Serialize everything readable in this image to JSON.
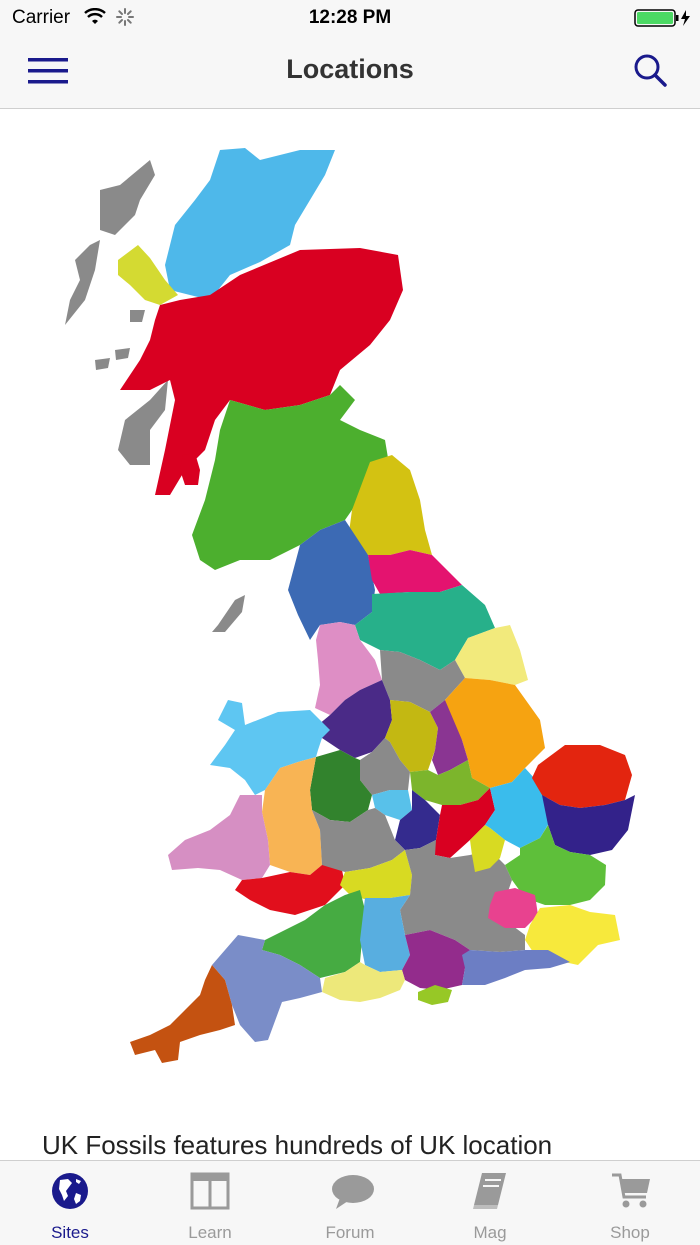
{
  "status_bar": {
    "carrier": "Carrier",
    "time": "12:28 PM"
  },
  "nav": {
    "title": "Locations",
    "menu_icon": "hamburger-menu-icon",
    "search_icon": "search-icon"
  },
  "map": {
    "label": "UK regions map"
  },
  "body": {
    "intro_text": "UK Fossils features hundreds of UK location"
  },
  "tabs": [
    {
      "label": "Sites",
      "icon": "globe-icon",
      "active": true
    },
    {
      "label": "Learn",
      "icon": "book-columns-icon",
      "active": false
    },
    {
      "label": "Forum",
      "icon": "chat-bubble-icon",
      "active": false
    },
    {
      "label": "Mag",
      "icon": "magazine-icon",
      "active": false
    },
    {
      "label": "Shop",
      "icon": "shopping-cart-icon",
      "active": false
    }
  ],
  "colors": {
    "accent": "#1a1a8c",
    "inactive": "#9a9a9a",
    "battery": "#4cd964"
  }
}
